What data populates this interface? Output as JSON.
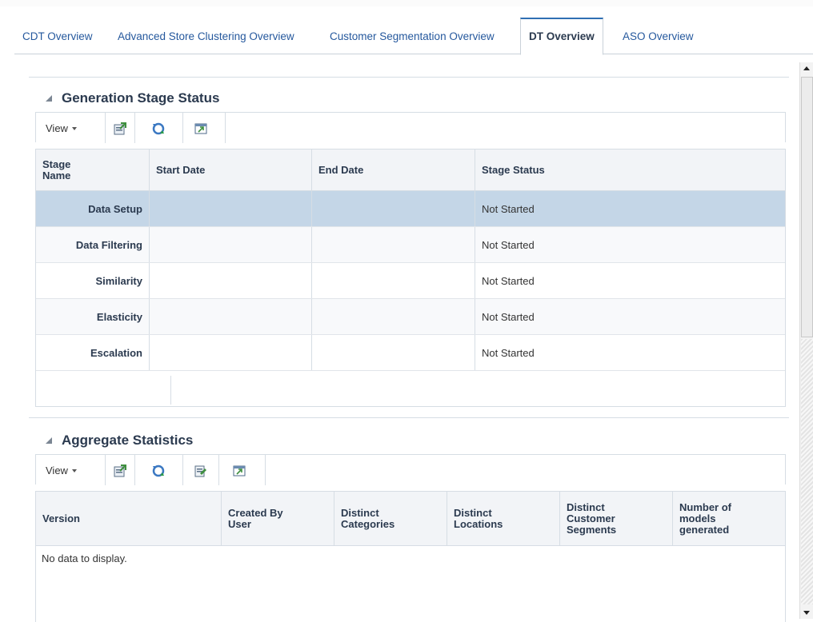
{
  "tabs": [
    {
      "label": "CDT Overview"
    },
    {
      "label": "Advanced Store Clustering Overview"
    },
    {
      "label": "Customer Segmentation Overview"
    },
    {
      "label": "DT Overview"
    },
    {
      "label": "ASO Overview"
    }
  ],
  "generation": {
    "title": "Generation Stage Status",
    "view_label": "View",
    "columns": [
      "Stage Name",
      "Start Date",
      "End Date",
      "Stage Status"
    ],
    "rows": [
      {
        "stage": "Data Setup",
        "start": "",
        "end": "",
        "status": "Not Started"
      },
      {
        "stage": "Data Filtering",
        "start": "",
        "end": "",
        "status": "Not Started"
      },
      {
        "stage": "Similarity",
        "start": "",
        "end": "",
        "status": "Not Started"
      },
      {
        "stage": "Elasticity",
        "start": "",
        "end": "",
        "status": "Not Started"
      },
      {
        "stage": "Escalation",
        "start": "",
        "end": "",
        "status": "Not Started"
      }
    ]
  },
  "aggregate": {
    "title": "Aggregate Statistics",
    "view_label": "View",
    "columns": [
      "Version",
      "Created By User",
      "Distinct Categories",
      "Distinct Locations",
      "Distinct Customer Segments",
      "Number of models generated"
    ],
    "empty_text": "No data to display."
  },
  "icons": {
    "export": "export-icon",
    "refresh": "refresh-icon",
    "edit": "edit-icon",
    "detach": "detach-icon"
  },
  "colors": {
    "selected_row": "#c4d6e7",
    "tab_active_border": "#2f6fb3",
    "link": "#25589d"
  }
}
